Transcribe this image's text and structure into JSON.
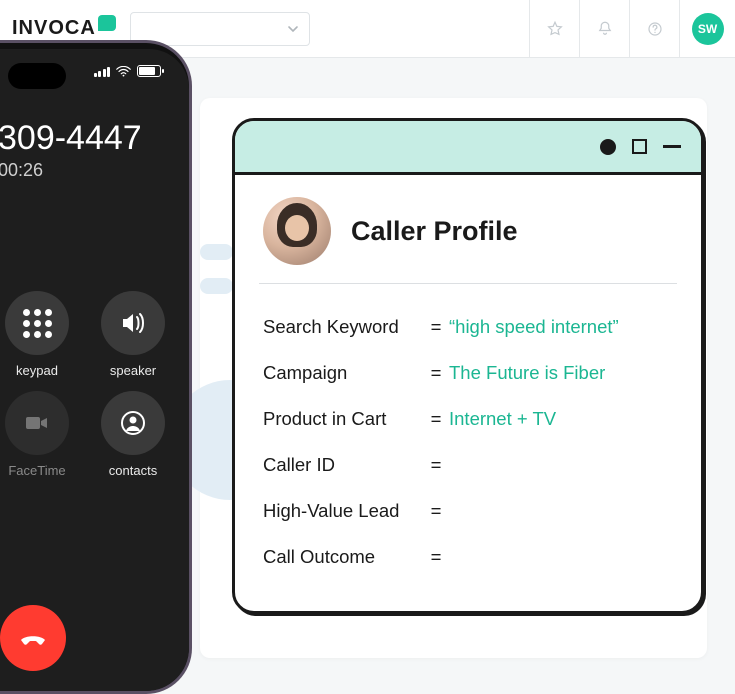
{
  "brand": {
    "name": "INVOCA"
  },
  "topbar": {
    "user_initials": "SW"
  },
  "phone": {
    "number": "309-4447",
    "duration": "00:26",
    "buttons": {
      "keypad": "keypad",
      "speaker": "speaker",
      "facetime": "FaceTime",
      "contacts": "contacts"
    }
  },
  "profile": {
    "title": "Caller Profile",
    "rows": [
      {
        "label": "Search Keyword",
        "value": "“high speed internet”"
      },
      {
        "label": "Campaign",
        "value": "The Future is Fiber"
      },
      {
        "label": "Product in Cart",
        "value": "Internet + TV"
      },
      {
        "label": "Caller ID",
        "value": ""
      },
      {
        "label": "High-Value Lead",
        "value": ""
      },
      {
        "label": "Call Outcome",
        "value": ""
      }
    ]
  }
}
